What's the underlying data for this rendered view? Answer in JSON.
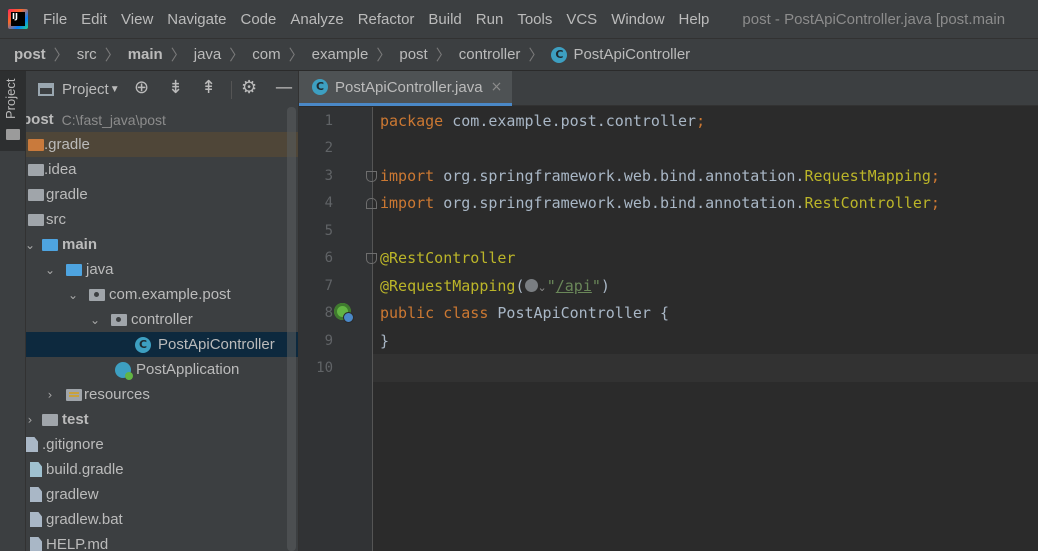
{
  "menu": {
    "items": [
      "File",
      "Edit",
      "View",
      "Navigate",
      "Code",
      "Analyze",
      "Refactor",
      "Build",
      "Run",
      "Tools",
      "VCS",
      "Window",
      "Help"
    ],
    "window_title": "post - PostApiController.java [post.main"
  },
  "breadcrumb": {
    "items": [
      "post",
      "src",
      "main",
      "java",
      "com",
      "example",
      "post",
      "controller",
      "PostApiController"
    ],
    "class_badge": "C"
  },
  "stripe": {
    "label": "Project"
  },
  "project_panel": {
    "title": "Project",
    "tree": [
      {
        "label": "post",
        "hint": "C:\\fast_java\\post",
        "bold": true
      },
      {
        "label": ".gradle"
      },
      {
        "label": ".idea"
      },
      {
        "label": "gradle"
      },
      {
        "label": "src"
      },
      {
        "label": "main",
        "bold": true
      },
      {
        "label": "java"
      },
      {
        "label": "com.example.post"
      },
      {
        "label": "controller"
      },
      {
        "label": "PostApiController",
        "badge": "C"
      },
      {
        "label": "PostApplication"
      },
      {
        "label": "resources"
      },
      {
        "label": "test",
        "bold": true
      },
      {
        "label": ".gitignore"
      },
      {
        "label": "build.gradle"
      },
      {
        "label": "gradlew"
      },
      {
        "label": "gradlew.bat"
      },
      {
        "label": "HELP.md"
      }
    ]
  },
  "editor": {
    "tab_label": "PostApiController.java",
    "tab_badge": "C",
    "tab_close": "×",
    "line_numbers": [
      "1",
      "2",
      "3",
      "4",
      "5",
      "6",
      "7",
      "8",
      "9",
      "10"
    ],
    "code": {
      "l1_kw": "package",
      "l1_rest": " com.example.post.controller",
      "l1_semi": ";",
      "l3_kw": "import",
      "l3_rest": " org.springframework.web.bind.annotation.",
      "l3_ann": "RequestMapping",
      "l3_semi": ";",
      "l4_kw": "import",
      "l4_rest": " org.springframework.web.bind.annotation.",
      "l4_ann": "RestController",
      "l4_semi": ";",
      "l6_ann": "@RestController",
      "l7_ann": "@RequestMapping",
      "l7_open": "(",
      "l7_str_q1": "\"",
      "l7_str_link": "/api",
      "l7_str_q2": "\"",
      "l7_close": ")",
      "l8_kw1": "public",
      "l8_kw2": "class",
      "l8_rest": " PostApiController {",
      "l9": "}"
    }
  }
}
